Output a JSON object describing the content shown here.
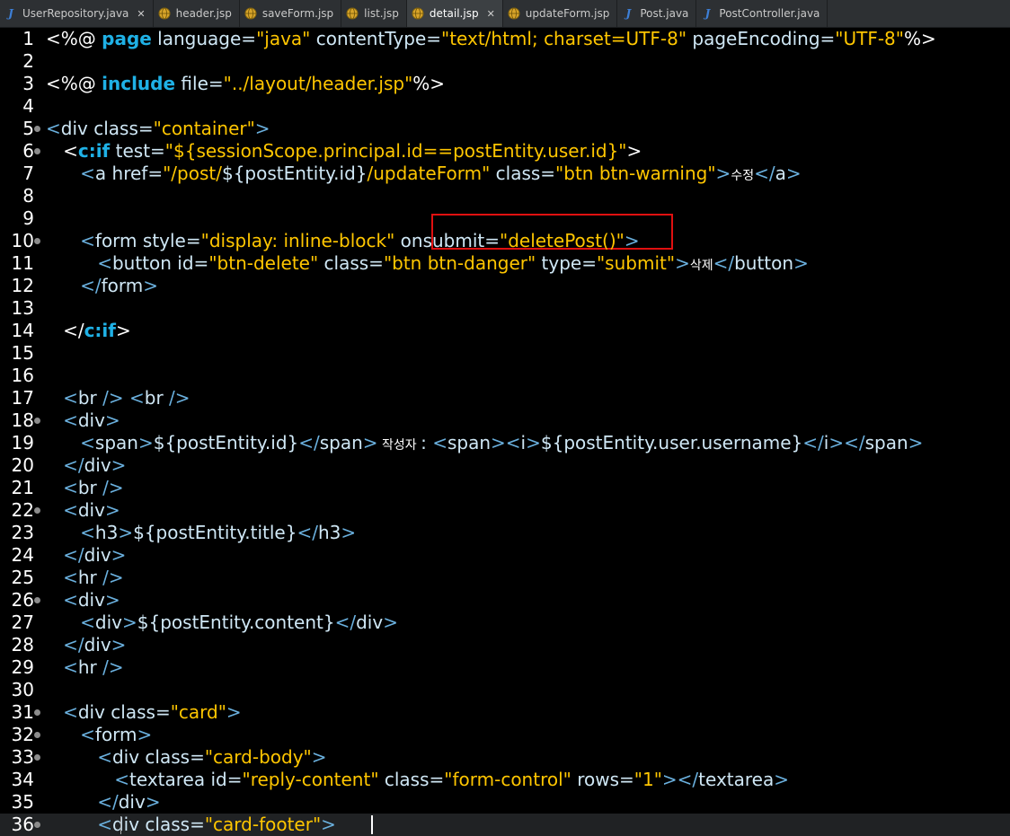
{
  "tabs": [
    {
      "label": "UserRepository.java",
      "icon": "java-icon",
      "active": false,
      "closable": true
    },
    {
      "label": "header.jsp",
      "icon": "jsp-icon",
      "active": false,
      "closable": false
    },
    {
      "label": "saveForm.jsp",
      "icon": "jsp-icon",
      "active": false,
      "closable": false
    },
    {
      "label": "list.jsp",
      "icon": "jsp-icon",
      "active": false,
      "closable": false
    },
    {
      "label": "detail.jsp",
      "icon": "jsp-icon",
      "active": true,
      "closable": true
    },
    {
      "label": "updateForm.jsp",
      "icon": "jsp-icon",
      "active": false,
      "closable": false
    },
    {
      "label": "Post.java",
      "icon": "java-icon",
      "active": false,
      "closable": false
    },
    {
      "label": "PostController.java",
      "icon": "java-icon",
      "active": false,
      "closable": false
    }
  ],
  "colors": {
    "background": "#000000",
    "string": "#ffc600",
    "tag": "#6ab0de",
    "keyword": "#1fb1e6",
    "highlight_box": "#e01010"
  },
  "lines": [
    {
      "n": "1",
      "fold": false,
      "tokens": [
        [
          "<%@ ",
          "white"
        ],
        [
          "page",
          "kw"
        ],
        [
          " language=",
          "attr"
        ],
        [
          "\"java\"",
          "str"
        ],
        [
          " contentType=",
          "attr"
        ],
        [
          "\"text/html; charset=UTF-8\"",
          "str"
        ],
        [
          " pageEncoding=",
          "attr"
        ],
        [
          "\"UTF-8\"",
          "str"
        ],
        [
          "%>",
          "white"
        ]
      ]
    },
    {
      "n": "2",
      "fold": false,
      "tokens": []
    },
    {
      "n": "3",
      "fold": false,
      "tokens": [
        [
          "<%@ ",
          "white"
        ],
        [
          "include",
          "kw"
        ],
        [
          " file=",
          "attr"
        ],
        [
          "\"../layout/header.jsp\"",
          "str"
        ],
        [
          "%>",
          "white"
        ]
      ]
    },
    {
      "n": "4",
      "fold": false,
      "tokens": []
    },
    {
      "n": "5",
      "fold": true,
      "tokens": [
        [
          "<",
          "tag"
        ],
        [
          "div",
          "attr"
        ],
        [
          " class=",
          "attr"
        ],
        [
          "\"container\"",
          "str"
        ],
        [
          ">",
          "tag"
        ]
      ]
    },
    {
      "n": "6",
      "fold": true,
      "tokens": [
        [
          "   <",
          "white"
        ],
        [
          "c:if",
          "kw"
        ],
        [
          " test=",
          "attr"
        ],
        [
          "\"${sessionScope.principal.id==postEntity.user.id}\"",
          "str"
        ],
        [
          ">",
          "white"
        ]
      ]
    },
    {
      "n": "7",
      "fold": false,
      "tokens": [
        [
          "      <",
          "tag"
        ],
        [
          "a href=",
          "attr"
        ],
        [
          "\"/post/",
          "str"
        ],
        [
          "${postEntity.id}",
          "attr"
        ],
        [
          "/updateForm\"",
          "str"
        ],
        [
          " class=",
          "attr"
        ],
        [
          "\"btn btn-warning\"",
          "str"
        ],
        [
          ">",
          "tag"
        ],
        [
          "수정",
          "kor"
        ],
        [
          "</",
          "tag"
        ],
        [
          "a",
          "attr"
        ],
        [
          ">",
          "tag"
        ]
      ]
    },
    {
      "n": "8",
      "fold": false,
      "tokens": []
    },
    {
      "n": "9",
      "fold": false,
      "tokens": []
    },
    {
      "n": "10",
      "fold": true,
      "tokens": [
        [
          "      <",
          "tag"
        ],
        [
          "form style=",
          "attr"
        ],
        [
          "\"display: ",
          "str"
        ],
        [
          "inline-block",
          "str"
        ],
        [
          "\"",
          "str"
        ],
        [
          " onsubmit=",
          "attr"
        ],
        [
          "\"deletePost()\"",
          "str"
        ],
        [
          ">",
          "tag"
        ]
      ]
    },
    {
      "n": "11",
      "fold": false,
      "tokens": [
        [
          "         <",
          "tag"
        ],
        [
          "button id=",
          "attr"
        ],
        [
          "\"btn-delete\"",
          "str"
        ],
        [
          " class=",
          "attr"
        ],
        [
          "\"btn btn-danger\"",
          "str"
        ],
        [
          " type=",
          "attr"
        ],
        [
          "\"submit\"",
          "str"
        ],
        [
          ">",
          "tag"
        ],
        [
          "삭제",
          "kor"
        ],
        [
          "</",
          "tag"
        ],
        [
          "button",
          "attr"
        ],
        [
          ">",
          "tag"
        ]
      ]
    },
    {
      "n": "12",
      "fold": false,
      "tokens": [
        [
          "      </",
          "tag"
        ],
        [
          "form",
          "attr"
        ],
        [
          ">",
          "tag"
        ]
      ]
    },
    {
      "n": "13",
      "fold": false,
      "tokens": []
    },
    {
      "n": "14",
      "fold": false,
      "tokens": [
        [
          "   </",
          "white"
        ],
        [
          "c:if",
          "kw"
        ],
        [
          ">",
          "white"
        ]
      ]
    },
    {
      "n": "15",
      "fold": false,
      "tokens": []
    },
    {
      "n": "16",
      "fold": false,
      "tokens": []
    },
    {
      "n": "17",
      "fold": false,
      "tokens": [
        [
          "   <",
          "tag"
        ],
        [
          "br ",
          "attr"
        ],
        [
          "/>",
          "tag"
        ],
        [
          " <",
          "tag"
        ],
        [
          "br ",
          "attr"
        ],
        [
          "/>",
          "tag"
        ]
      ]
    },
    {
      "n": "18",
      "fold": true,
      "tokens": [
        [
          "   <",
          "tag"
        ],
        [
          "div",
          "attr"
        ],
        [
          ">",
          "tag"
        ]
      ]
    },
    {
      "n": "19",
      "fold": false,
      "tokens": [
        [
          "      <",
          "tag"
        ],
        [
          "span",
          "attr"
        ],
        [
          ">",
          "tag"
        ],
        [
          "${postEntity.id}",
          "attr"
        ],
        [
          "</",
          "tag"
        ],
        [
          "span",
          "attr"
        ],
        [
          ">",
          "tag"
        ],
        [
          " 작성자 ",
          "kor"
        ],
        [
          ": ",
          "attr"
        ],
        [
          "<",
          "tag"
        ],
        [
          "span",
          "attr"
        ],
        [
          ">",
          "tag"
        ],
        [
          "<",
          "tag"
        ],
        [
          "i",
          "attr"
        ],
        [
          ">",
          "tag"
        ],
        [
          "${postEntity.user.username}",
          "attr"
        ],
        [
          "</",
          "tag"
        ],
        [
          "i",
          "attr"
        ],
        [
          ">",
          "tag"
        ],
        [
          "</",
          "tag"
        ],
        [
          "span",
          "attr"
        ],
        [
          ">",
          "tag"
        ]
      ]
    },
    {
      "n": "20",
      "fold": false,
      "tokens": [
        [
          "   </",
          "tag"
        ],
        [
          "div",
          "attr"
        ],
        [
          ">",
          "tag"
        ]
      ]
    },
    {
      "n": "21",
      "fold": false,
      "tokens": [
        [
          "   <",
          "tag"
        ],
        [
          "br ",
          "attr"
        ],
        [
          "/>",
          "tag"
        ]
      ]
    },
    {
      "n": "22",
      "fold": true,
      "tokens": [
        [
          "   <",
          "tag"
        ],
        [
          "div",
          "attr"
        ],
        [
          ">",
          "tag"
        ]
      ]
    },
    {
      "n": "23",
      "fold": false,
      "tokens": [
        [
          "      <",
          "tag"
        ],
        [
          "h3",
          "attr"
        ],
        [
          ">",
          "tag"
        ],
        [
          "${postEntity.title}",
          "attr"
        ],
        [
          "</",
          "tag"
        ],
        [
          "h3",
          "attr"
        ],
        [
          ">",
          "tag"
        ]
      ]
    },
    {
      "n": "24",
      "fold": false,
      "tokens": [
        [
          "   </",
          "tag"
        ],
        [
          "div",
          "attr"
        ],
        [
          ">",
          "tag"
        ]
      ]
    },
    {
      "n": "25",
      "fold": false,
      "tokens": [
        [
          "   <",
          "tag"
        ],
        [
          "hr ",
          "attr"
        ],
        [
          "/>",
          "tag"
        ]
      ]
    },
    {
      "n": "26",
      "fold": true,
      "tokens": [
        [
          "   <",
          "tag"
        ],
        [
          "div",
          "attr"
        ],
        [
          ">",
          "tag"
        ]
      ]
    },
    {
      "n": "27",
      "fold": false,
      "tokens": [
        [
          "      <",
          "tag"
        ],
        [
          "div",
          "attr"
        ],
        [
          ">",
          "tag"
        ],
        [
          "${postEntity.content}",
          "attr"
        ],
        [
          "</",
          "tag"
        ],
        [
          "div",
          "attr"
        ],
        [
          ">",
          "tag"
        ]
      ]
    },
    {
      "n": "28",
      "fold": false,
      "tokens": [
        [
          "   </",
          "tag"
        ],
        [
          "div",
          "attr"
        ],
        [
          ">",
          "tag"
        ]
      ]
    },
    {
      "n": "29",
      "fold": false,
      "tokens": [
        [
          "   <",
          "tag"
        ],
        [
          "hr ",
          "attr"
        ],
        [
          "/>",
          "tag"
        ]
      ]
    },
    {
      "n": "30",
      "fold": false,
      "tokens": []
    },
    {
      "n": "31",
      "fold": true,
      "tokens": [
        [
          "   <",
          "tag"
        ],
        [
          "div",
          "attr"
        ],
        [
          " class=",
          "attr"
        ],
        [
          "\"card\"",
          "str"
        ],
        [
          ">",
          "tag"
        ]
      ]
    },
    {
      "n": "32",
      "fold": true,
      "tokens": [
        [
          "      <",
          "tag"
        ],
        [
          "form",
          "attr"
        ],
        [
          ">",
          "tag"
        ]
      ]
    },
    {
      "n": "33",
      "fold": true,
      "tokens": [
        [
          "         <",
          "tag"
        ],
        [
          "div",
          "attr"
        ],
        [
          " class=",
          "attr"
        ],
        [
          "\"card-body\"",
          "str"
        ],
        [
          ">",
          "tag"
        ]
      ]
    },
    {
      "n": "34",
      "fold": false,
      "tokens": [
        [
          "            <",
          "tag"
        ],
        [
          "textarea id=",
          "attr"
        ],
        [
          "\"reply-content\"",
          "str"
        ],
        [
          " class=",
          "attr"
        ],
        [
          "\"form-control\"",
          "str"
        ],
        [
          " rows=",
          "attr"
        ],
        [
          "\"1\"",
          "str"
        ],
        [
          ">",
          "tag"
        ],
        [
          "</",
          "tag"
        ],
        [
          "textarea",
          "attr"
        ],
        [
          ">",
          "tag"
        ]
      ]
    },
    {
      "n": "35",
      "fold": false,
      "tokens": [
        [
          "         </",
          "tag"
        ],
        [
          "div",
          "attr"
        ],
        [
          ">",
          "tag"
        ]
      ]
    },
    {
      "n": "36",
      "fold": true,
      "current": true,
      "tokens": [
        [
          "         <",
          "tag"
        ],
        [
          "div",
          "attr"
        ],
        [
          " class=",
          "attr"
        ],
        [
          "\"card-footer\"",
          "str"
        ],
        [
          ">",
          "tag"
        ]
      ]
    }
  ]
}
